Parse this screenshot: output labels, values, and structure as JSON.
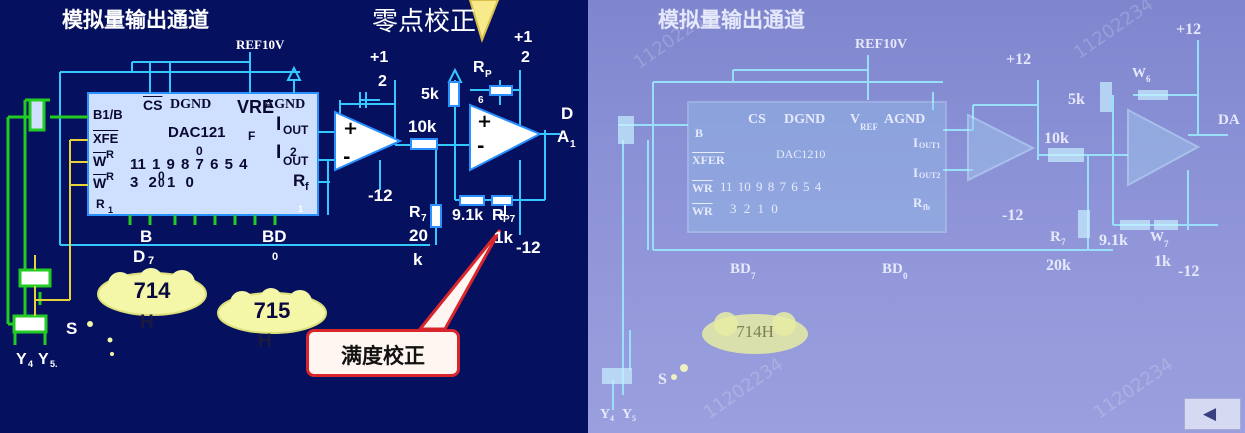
{
  "left": {
    "title": "模拟量输出通道",
    "ref": "REF10V",
    "zero_label": "零点校正",
    "full_scale_label": "满度校正",
    "chip": {
      "b1b": "B1/B",
      "b1b_sub": "1",
      "cs": "CS",
      "dgnd": "DGND",
      "vref": "VRE",
      "vref_f": "F",
      "agnd": "AGND",
      "name": "DAC121",
      "name_0": "0",
      "xfe": "XFE",
      "wr1": "W",
      "wr1b": "R",
      "wr2": "W",
      "wr2b": "R",
      "r1": "R",
      "r1_sub": "1",
      "bits_top": "11 1  9  8  7 6 5 4",
      "bits_top2": "0",
      "bits_bot": "3  2  1 0",
      "bits_bot2": "0",
      "iout1": "I",
      "iout1_sub": "OUT",
      "iout2": "I",
      "iout2_sub": "OUT",
      "iout2_2": "2",
      "rf": "R",
      "rf_sub": "f",
      "pin1": "1",
      "b": "B",
      "d7": "D",
      "d7_sub": "7",
      "bd": "BD",
      "bd_sub": "0"
    },
    "supply1": "+1",
    "supply1b": "2",
    "supply2": "+1",
    "supply2b": "2",
    "neg12": "-12",
    "neg12b": "-12",
    "r5k": "5k",
    "rp": "R",
    "rp_sub": "P",
    "r10k": "10k",
    "six": "6",
    "out_d": "D",
    "out_a": "A",
    "out_a_sub": "1",
    "r7": "R",
    "r7_sub": "7",
    "r7_val": "20",
    "r7_k": "k",
    "r91": "9.1k",
    "rp7": "R",
    "rp7_sub": "P7",
    "rp7_val": "1k",
    "y4": "Y",
    "y4_sub": "4",
    "y5": "Y",
    "y5_sub": "5.",
    "s": "S",
    "cloud1": "714",
    "cloud1_h": "H",
    "cloud2": "715",
    "cloud2_h": "H"
  },
  "right": {
    "title": "模拟量输出通道",
    "ref": "REF10V",
    "plus12a": "+12",
    "plus12b": "+12",
    "r5k": "5k",
    "w6": "W",
    "w6_sub": "6",
    "out": "DA",
    "r10k": "10k",
    "chip_b1": "B",
    "chip_cs": "CS",
    "chip_dgnd": "DGND",
    "chip_vref": "V",
    "chip_vref_sub": "REF",
    "chip_agnd": "AGND",
    "chip_name": "DAC1210",
    "chip_xfer": "XFER",
    "chip_wr1": "WR",
    "chip_wr2": "WR",
    "chip_bits_top": "11 10 9  8  7  6  5  4",
    "chip_bits_bot": "3  2  1  0",
    "chip_iout1": "I",
    "chip_iout1_sub": "OUT1",
    "chip_iout2": "I",
    "chip_iout2_sub": "OUT2",
    "chip_rfb": "R",
    "chip_rfb_sub": "fb",
    "minus12a": "-12",
    "minus12b": "-12",
    "r7": "R",
    "r7_sub": "7",
    "r7_val": "20k",
    "r91": "9.1k",
    "w7": "W",
    "w7_sub": "7",
    "w7_val": "1k",
    "bd7": "BD",
    "bd7_sub": "7",
    "bd0": "BD",
    "bd0_sub": "0",
    "cloud": "714H",
    "s": "S",
    "y4": "Y",
    "y4_sub": "4",
    "y5": "Y",
    "y5_sub": "5",
    "watermark": "11202234",
    "back_icon": "◀"
  },
  "colors": {
    "left_bg": "#05105e",
    "chip_fill": "#cfe0ff",
    "wire_cyan": "#35c8ff",
    "wire_green": "#22cc22",
    "wire_yellow": "#e8d23a",
    "red": "#d8262c",
    "right_bg": "#8c92d6",
    "right_wire": "#8fe3ff"
  }
}
